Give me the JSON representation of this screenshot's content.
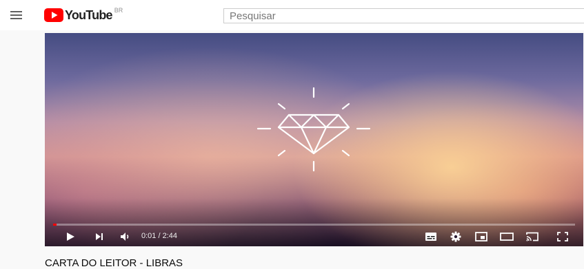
{
  "header": {
    "logo_text": "YouTube",
    "country_code": "BR",
    "search_placeholder": "Pesquisar",
    "icons": [
      "menu-icon",
      "youtube-logo-icon"
    ]
  },
  "player": {
    "current_time": "0:01",
    "duration": "2:44",
    "time_display": "0:01 / 2:44",
    "progress_fraction": 0.006,
    "buffered_fraction": 0.0,
    "icons": [
      "play-icon",
      "next-icon",
      "volume-icon",
      "subtitles-icon",
      "settings-icon",
      "miniplayer-icon",
      "theater-mode-icon",
      "cast-icon",
      "fullscreen-icon"
    ],
    "accent_color": "#ff0000"
  },
  "video": {
    "title": "CARTA DO LEITOR - LIBRAS"
  }
}
